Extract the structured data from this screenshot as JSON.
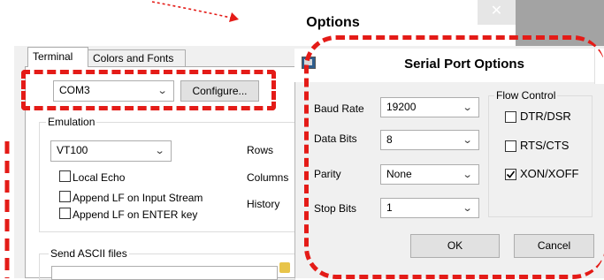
{
  "options_window": {
    "title": "Options",
    "close_glyph": "✕",
    "tabs": [
      {
        "label": "Terminal",
        "selected": true
      },
      {
        "label": "Colors and Fonts",
        "selected": false
      }
    ],
    "port_select": {
      "value": "COM3"
    },
    "configure_button": "Configure...",
    "emulation": {
      "group_label": "Emulation",
      "select_value": "VT100",
      "side_labels": [
        "Rows",
        "Columns",
        "History"
      ]
    },
    "checkboxes": [
      {
        "label": "Local Echo",
        "checked": false
      },
      {
        "label": "Append LF on Input Stream",
        "checked": false
      },
      {
        "label": "Append LF on ENTER key",
        "checked": false
      }
    ],
    "send_ascii": {
      "group_label": "Send ASCII files"
    }
  },
  "serial_dialog": {
    "title": "Serial Port Options",
    "fields": [
      {
        "label": "Baud Rate",
        "value": "19200"
      },
      {
        "label": "Data Bits",
        "value": "8"
      },
      {
        "label": "Parity",
        "value": "None"
      },
      {
        "label": "Stop Bits",
        "value": "1"
      }
    ],
    "flow_control": {
      "group_label": "Flow Control",
      "options": [
        {
          "label": "DTR/DSR",
          "checked": false
        },
        {
          "label": "RTS/CTS",
          "checked": false
        },
        {
          "label": "XON/XOFF",
          "checked": true
        }
      ]
    },
    "ok_button": "OK",
    "cancel_button": "Cancel"
  },
  "annotation_color": "#e41b17",
  "icons": {
    "dropdown": "chevron-down-icon",
    "checkmark": "check-icon",
    "close": "close-icon"
  }
}
